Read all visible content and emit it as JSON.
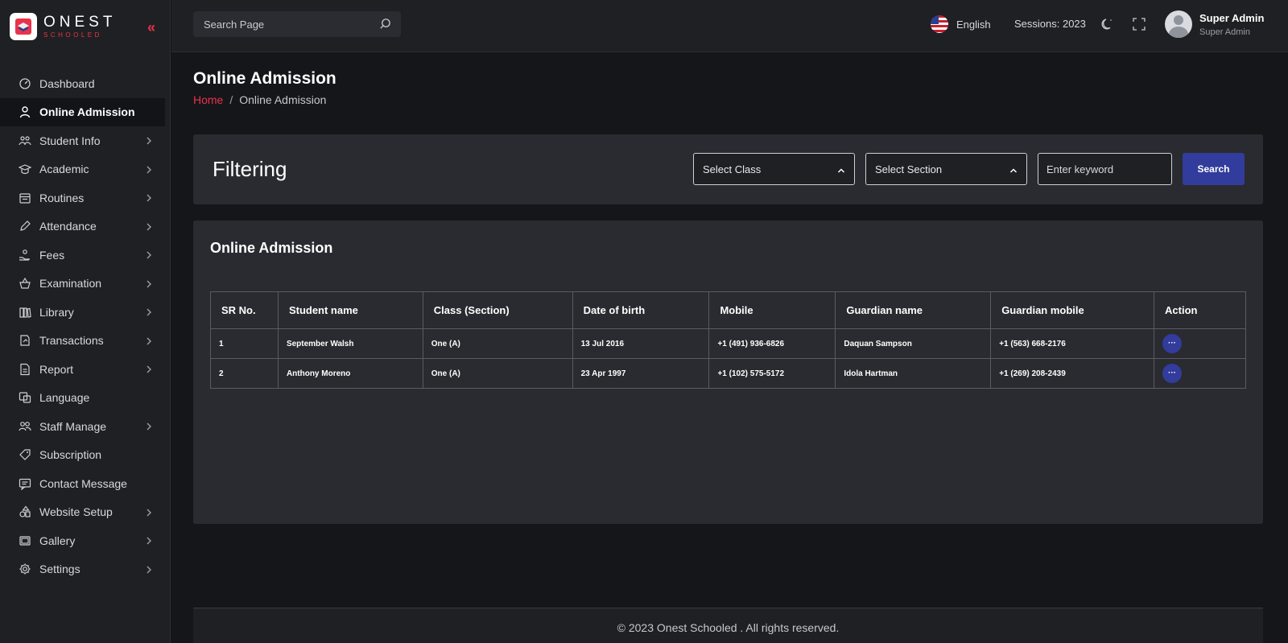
{
  "brand": {
    "name": "ONEST",
    "tagline": "SCHOOLED",
    "accent": "#e8334a",
    "primary": "#323c9c"
  },
  "sidebar": {
    "items": [
      {
        "label": "Dashboard",
        "icon": "dashboard-icon",
        "chevron": false
      },
      {
        "label": "Online Admission",
        "icon": "user-icon",
        "chevron": false,
        "active": true
      },
      {
        "label": "Student Info",
        "icon": "students-icon",
        "chevron": true
      },
      {
        "label": "Academic",
        "icon": "graduation-cap-icon",
        "chevron": true
      },
      {
        "label": "Routines",
        "icon": "calendar-icon",
        "chevron": true
      },
      {
        "label": "Attendance",
        "icon": "pen-icon",
        "chevron": true
      },
      {
        "label": "Fees",
        "icon": "hand-coin-icon",
        "chevron": true
      },
      {
        "label": "Examination",
        "icon": "basket-icon",
        "chevron": true
      },
      {
        "label": "Library",
        "icon": "books-icon",
        "chevron": true
      },
      {
        "label": "Transactions",
        "icon": "transaction-icon",
        "chevron": true
      },
      {
        "label": "Report",
        "icon": "document-icon",
        "chevron": true
      },
      {
        "label": "Language",
        "icon": "translate-icon",
        "chevron": false
      },
      {
        "label": "Staff Manage",
        "icon": "people-icon",
        "chevron": true
      },
      {
        "label": "Subscription",
        "icon": "tag-icon",
        "chevron": false
      },
      {
        "label": "Contact Message",
        "icon": "message-icon",
        "chevron": false
      },
      {
        "label": "Website Setup",
        "icon": "shapes-icon",
        "chevron": true
      },
      {
        "label": "Gallery",
        "icon": "gallery-icon",
        "chevron": true
      },
      {
        "label": "Settings",
        "icon": "gear-icon",
        "chevron": true
      }
    ]
  },
  "topbar": {
    "search_placeholder": "Search Page",
    "language": "English",
    "sessions": "Sessions: 2023",
    "user_name": "Super Admin",
    "user_role": "Super Admin"
  },
  "page": {
    "title": "Online Admission",
    "breadcrumb_home": "Home",
    "breadcrumb_sep": "/",
    "breadcrumb_current": "Online Admission"
  },
  "filter": {
    "title": "Filtering",
    "class_placeholder": "Select Class",
    "section_placeholder": "Select Section",
    "keyword_placeholder": "Enter keyword",
    "search_label": "Search"
  },
  "table": {
    "title": "Online Admission",
    "columns": [
      "SR No.",
      "Student name",
      "Class (Section)",
      "Date of birth",
      "Mobile",
      "Guardian name",
      "Guardian mobile",
      "Action"
    ],
    "rows": [
      [
        "1",
        "September Walsh",
        "One (A)",
        "13 Jul 2016",
        "+1 (491) 936-6826",
        "Daquan Sampson",
        "+1 (563) 668-2176"
      ],
      [
        "2",
        "Anthony Moreno",
        "One (A)",
        "23 Apr 1997",
        "+1 (102) 575-5172",
        "Idola Hartman",
        "+1 (269) 208-2439"
      ]
    ],
    "action_glyph": "···"
  },
  "footer": {
    "text": "© 2023 Onest Schooled . All rights reserved."
  }
}
